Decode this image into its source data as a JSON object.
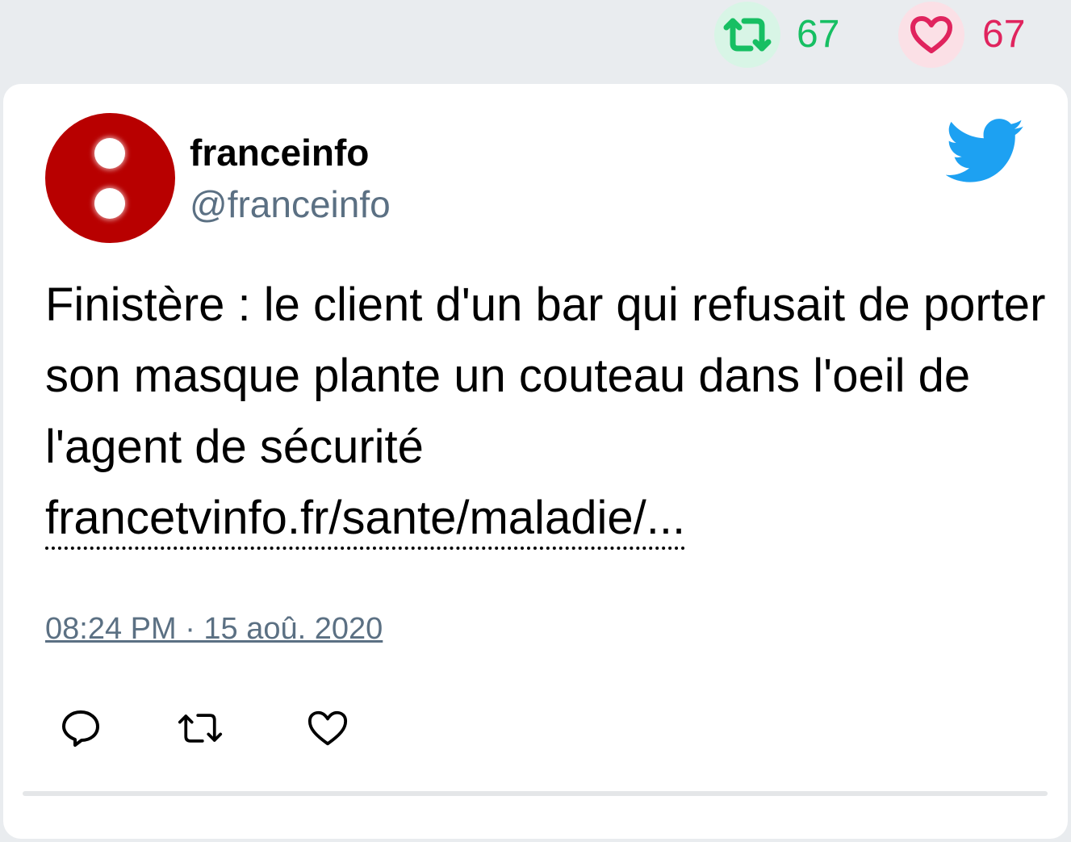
{
  "stats": {
    "retweet_count": "67",
    "like_count": "67"
  },
  "tweet": {
    "display_name": "franceinfo",
    "handle": "@franceinfo",
    "text": "Finistère : le client d'un bar qui refusait de porter son masque plante un couteau dans l'oeil de l'agent de sécurité",
    "link": "francetvinfo.fr/sante/maladie/...",
    "timestamp": "08:24 PM · 15 aoû. 2020"
  },
  "icons": {
    "retweet": "retweet-icon",
    "like": "heart-icon",
    "reply": "reply-icon",
    "brand": "twitter-bird-icon"
  },
  "colors": {
    "retweet": "#17bf63",
    "like": "#e0245e",
    "twitter_blue": "#1da1f2",
    "avatar": "#b80000",
    "secondary_text": "#5b7083"
  }
}
